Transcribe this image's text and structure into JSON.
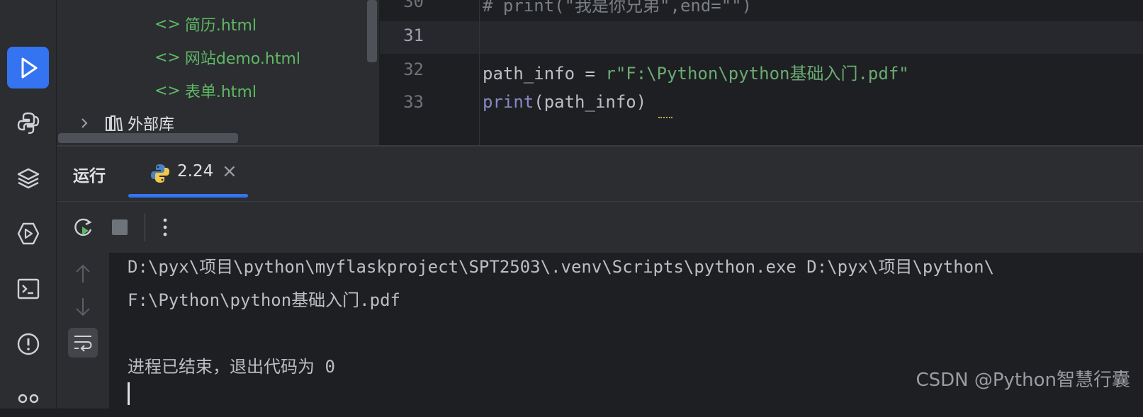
{
  "project_tree": {
    "items": [
      {
        "icon": "<>",
        "label": "简历.html"
      },
      {
        "icon": "<>",
        "label": "网站demo.html"
      },
      {
        "icon": "<>",
        "label": "表单.html"
      }
    ],
    "external_libs": "外部库"
  },
  "editor": {
    "line_numbers": [
      "30",
      "31",
      "32",
      "33"
    ],
    "line30_comment": "# print(\"我是你兄弟\",end=\"\")",
    "line32_var": "path_info = ",
    "line32_str": "r\"F:\\Python\\python基础入门.pdf\"",
    "line33_builtin": "print",
    "line33_rest": "(path_info)"
  },
  "run_panel": {
    "title": "运行",
    "tab_label": "2.24",
    "tab_close": "×"
  },
  "console": {
    "lines": [
      "D:\\pyx\\项目\\python\\myflaskproject\\SPT2503\\.venv\\Scripts\\python.exe D:\\pyx\\项目\\python\\",
      "F:\\Python\\python基础入门.pdf",
      "",
      "进程已结束，退出代码为 0"
    ]
  },
  "watermark": "CSDN @Python智慧行囊",
  "colors": {
    "accent": "#3574f0",
    "string": "#6aab73",
    "builtin": "#8888c6",
    "html_file": "#5fb865"
  }
}
